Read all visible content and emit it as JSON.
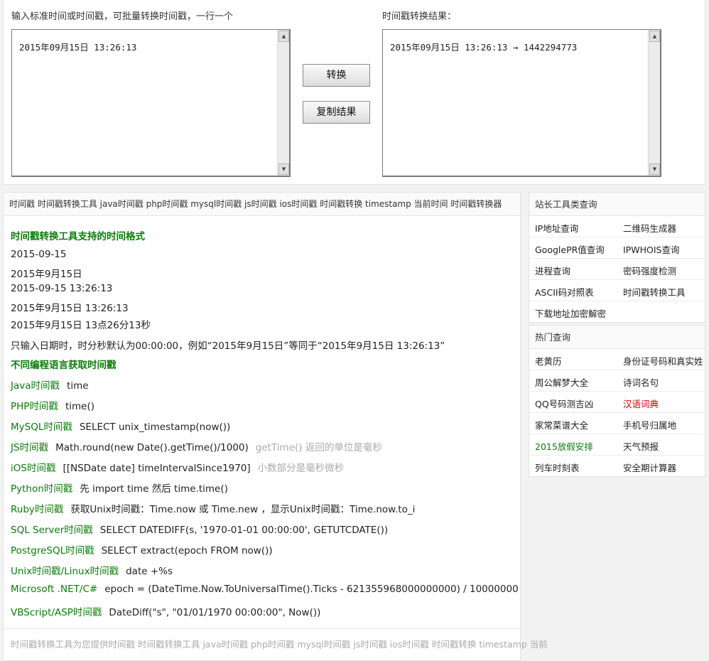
{
  "converter": {
    "input_label": "输入标准时间或时间戳，可批量转换时间戳，一行一个",
    "input_value": "2015年09月15日 13:26:13",
    "result_label": "时间戳转换结果：",
    "result_value": "2015年09月15日 13:26:13 → 1442294773",
    "convert_button": "转换",
    "copy_button": "复制结果"
  },
  "main": {
    "tags": "时间戳 时间戳转换工具 java时间戳 php时间戳 mysql时间戳 js时间戳 ios时间戳 时间戳转换 timestamp 当前时间 时间戳转换器",
    "formats_title": "时间戳转换工具支持的时间格式",
    "formats": [
      "2015-09-15",
      "2015年9月15日",
      "2015-09-15 13:26:13",
      "2015年9月15日 13:26:13",
      "2015年9月15日 13点26分13秒"
    ],
    "format_note": "只输入日期时，时分秒默认为00:00:00，例如“2015年9月15日”等同于“2015年9月15日 13:26:13”",
    "lang_title": "不同编程语言获取时间戳",
    "langs": [
      {
        "name": "Java时间戳",
        "code": "time",
        "note": ""
      },
      {
        "name": "PHP时间戳",
        "code": "time()",
        "note": ""
      },
      {
        "name": "MySQL时间戳",
        "code": "SELECT unix_timestamp(now())",
        "note": ""
      },
      {
        "name": "JS时间戳",
        "code": "Math.round(new Date().getTime()/1000)",
        "note": "getTime() 返回的单位是毫秒"
      },
      {
        "name": "iOS时间戳",
        "code": "[[NSDate date] timeIntervalSince1970]",
        "note": "小数部分是毫秒微秒"
      },
      {
        "name": "Python时间戳",
        "code": "先 import time 然后 time.time()",
        "note": ""
      },
      {
        "name": "Ruby时间戳",
        "code": "获取Unix时间戳：Time.now 或 Time.new ，显示Unix时间戳：Time.now.to_i",
        "note": ""
      },
      {
        "name": "SQL Server时间戳",
        "code": "SELECT DATEDIFF(s, '1970-01-01 00:00:00', GETUTCDATE())",
        "note": ""
      },
      {
        "name": "PostgreSQL时间戳",
        "code": "SELECT extract(epoch FROM now())",
        "note": ""
      },
      {
        "name": "Unix时间戳/Linux时间戳",
        "code": "date +%s",
        "note": ""
      },
      {
        "name": "Microsoft .NET/C#",
        "code": "epoch = (DateTime.Now.ToUniversalTime().Ticks - 621355968000000000) / 10000000",
        "note": ""
      },
      {
        "name": "VBScript/ASP时间戳",
        "code": "DateDiff(\"s\", \"01/01/1970 00:00:00\", Now())",
        "note": ""
      }
    ],
    "footer": "时间戳转换工具为您提供时间戳 时间戳转换工具 java时间戳 php时间戳 mysql时间戳 js时间戳 ios时间戳 时间戳转换 timestamp 当前"
  },
  "sidebar": {
    "tools_title": "站长工具类查询",
    "tools": [
      [
        "IP地址查询",
        "二维码生成器"
      ],
      [
        "GooglePR值查询",
        "IPWHOIS查询"
      ],
      [
        "进程查询",
        "密码强度检测"
      ],
      [
        "ASCII码对照表",
        "时间戳转换工具"
      ],
      [
        "下载地址加密解密",
        ""
      ]
    ],
    "hot_title": "热门查询",
    "hot": [
      [
        "老黄历",
        "身份证号码和真实姓"
      ],
      [
        "周公解梦大全",
        "诗词名句"
      ],
      [
        "QQ号码测吉凶",
        "汉语词典"
      ],
      [
        "家常菜谱大全",
        "手机号归属地"
      ],
      [
        "2015放假安排",
        "天气预报"
      ],
      [
        "列车时刻表",
        "安全期计算器"
      ]
    ],
    "colors": {
      "highlight_red": "#d10000",
      "highlight_green": "#0a7d0a"
    }
  }
}
